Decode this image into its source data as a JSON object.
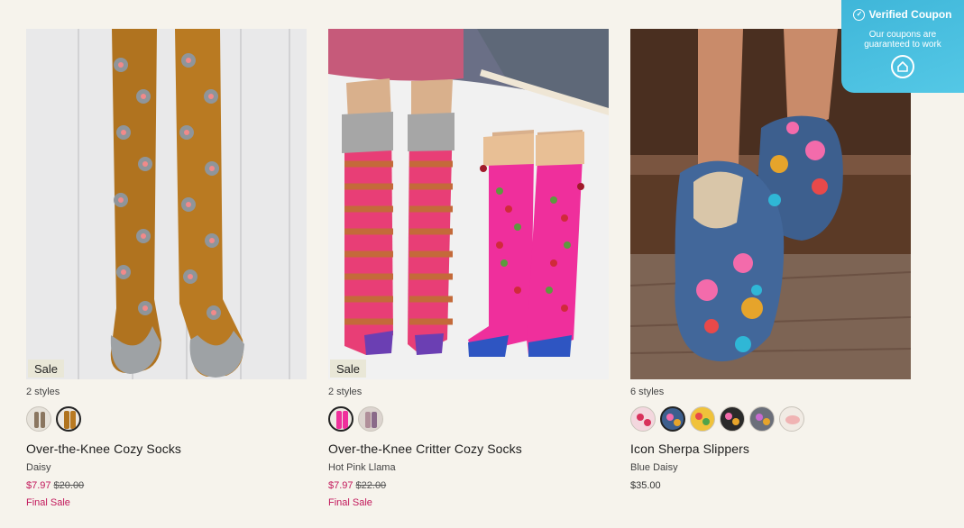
{
  "coupon": {
    "title": "Verified Coupon",
    "subtitle": "Our coupons are guaranteed to work",
    "icon": "coupon-logo-icon"
  },
  "products": [
    {
      "sale_badge": "Sale",
      "styles": "2 styles",
      "name": "Over-the-Knee Cozy Socks",
      "variant": "Daisy",
      "price": "$7.97",
      "original_price": "$20.00",
      "final_sale": "Final Sale"
    },
    {
      "sale_badge": "Sale",
      "styles": "2 styles",
      "name": "Over-the-Knee Critter Cozy Socks",
      "variant": "Hot Pink Llama",
      "price": "$7.97",
      "original_price": "$22.00",
      "final_sale": "Final Sale"
    },
    {
      "styles": "6 styles",
      "name": "Icon Sherpa Slippers",
      "variant": "Blue Daisy",
      "price": "$35.00"
    }
  ],
  "colors": {
    "sale_price": "#c2185b",
    "badge_bg": "#e9e7d7",
    "coupon_bg": "#47bfe0"
  }
}
